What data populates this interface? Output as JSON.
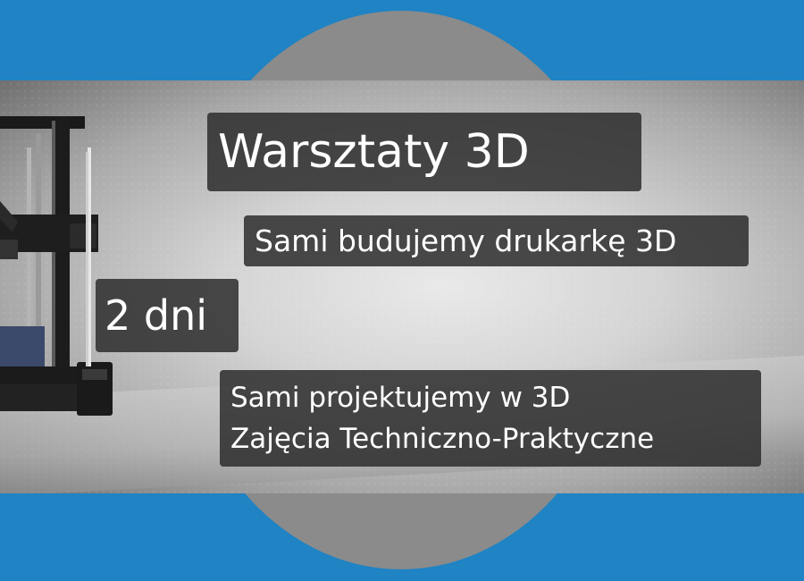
{
  "banner": {
    "title": "Warsztaty 3D",
    "subtitle": "Sami budujemy drukarkę 3D",
    "duration": "2 dni",
    "details": [
      "Sami projektujemy w 3D",
      "Zajęcia Techniczno-Praktyczne"
    ]
  },
  "colors": {
    "background": "#1f83c4",
    "circle": "#8b8b8b",
    "label_background": "#2d2d2d",
    "text": "#ffffff"
  },
  "image": {
    "subject": "3d-printer-photo"
  }
}
